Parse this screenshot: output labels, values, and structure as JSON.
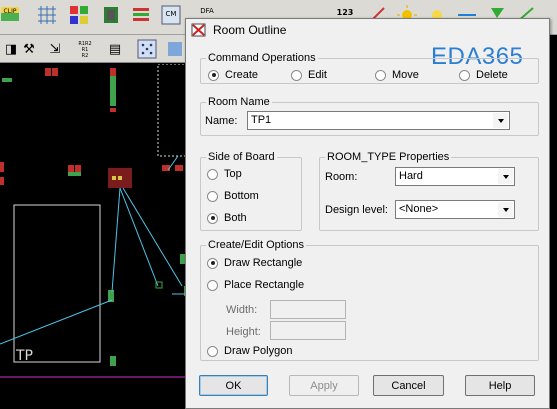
{
  "toolbar": {
    "clip_label": "CLIP",
    "count_label": "123",
    "cm_label": "CM",
    "dfa_label": "DFA",
    "r1r2_label": "R1R2\nR1\nR2"
  },
  "canvas": {
    "room_label": "TP"
  },
  "dialog": {
    "title": "Room Outline",
    "watermark": "EDA365",
    "command_operations": {
      "legend": "Command Operations",
      "options": [
        "Create",
        "Edit",
        "Move",
        "Delete"
      ],
      "selected": "Create"
    },
    "room_name": {
      "legend": "Room Name",
      "name_label": "Name:",
      "name_value": "TP1"
    },
    "side_of_board": {
      "legend": "Side of Board",
      "options": [
        "Top",
        "Bottom",
        "Both"
      ],
      "selected": "Both"
    },
    "room_type": {
      "legend": "ROOM_TYPE Properties",
      "room_label": "Room:",
      "room_value": "Hard",
      "design_level_label": "Design level:",
      "design_level_value": "<None>"
    },
    "create_edit": {
      "legend": "Create/Edit Options",
      "draw_rectangle": "Draw Rectangle",
      "place_rectangle": "Place Rectangle",
      "width_label": "Width:",
      "height_label": "Height:",
      "draw_polygon": "Draw Polygon",
      "selected": "Draw Rectangle"
    },
    "buttons": {
      "ok": "OK",
      "apply": "Apply",
      "cancel": "Cancel",
      "help": "Help"
    }
  },
  "colors": {
    "canvas_bg": "#000000",
    "trace": "#4fc3e8",
    "board_outline": "#d9d9d9",
    "pad": "#c0302b",
    "component_green": "#3fa34d",
    "dialog_bg": "#f0f0f0",
    "watermark": "#2a7fd4"
  }
}
